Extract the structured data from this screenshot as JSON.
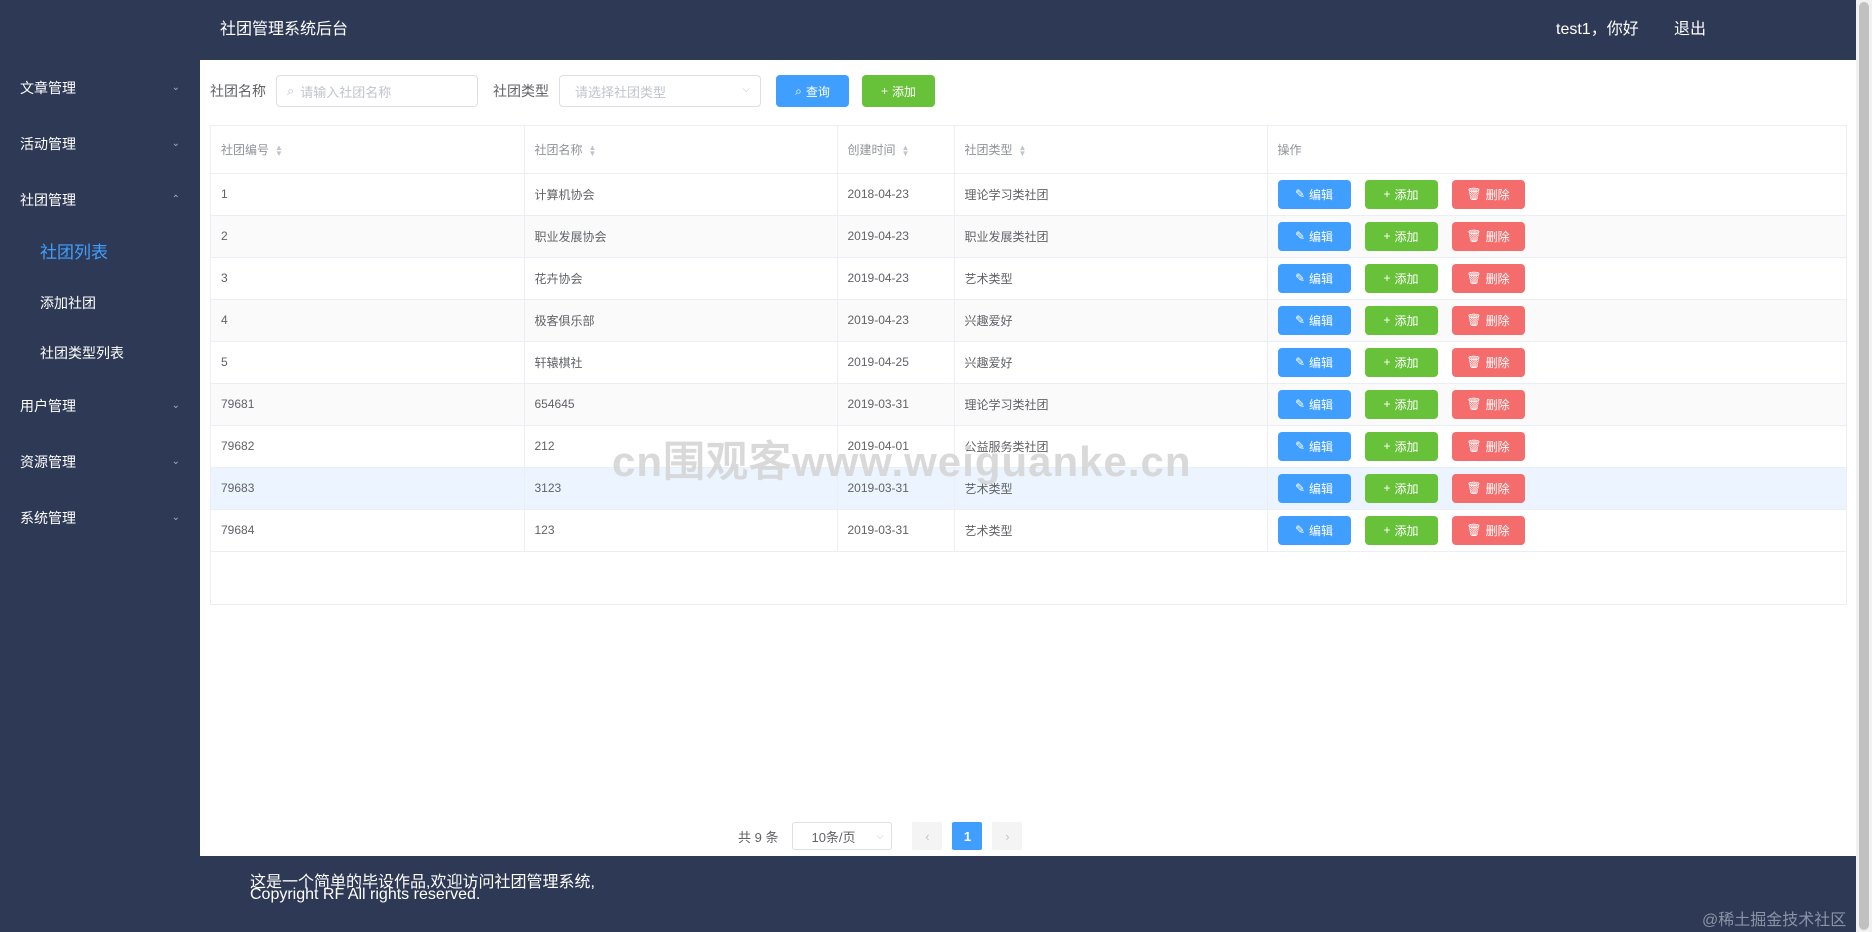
{
  "header": {
    "title": "社团管理系统后台",
    "user": "test1，你好",
    "logout": "退出"
  },
  "sidebar": {
    "menus": [
      {
        "label": "文章管理",
        "arrow": "⌄"
      },
      {
        "label": "活动管理",
        "arrow": "⌄"
      },
      {
        "label": "社团管理",
        "arrow": "⌃"
      },
      {
        "label": "用户管理",
        "arrow": "⌄"
      },
      {
        "label": "资源管理",
        "arrow": "⌄"
      },
      {
        "label": "系统管理",
        "arrow": "⌄"
      }
    ],
    "club_submenu": [
      "社团列表",
      "添加社团",
      "社团类型列表"
    ]
  },
  "search": {
    "name_label": "社团名称",
    "name_placeholder": "请输入社团名称",
    "type_label": "社团类型",
    "type_placeholder": "请选择社团类型",
    "query_button": "查询",
    "add_button": "添加"
  },
  "table": {
    "headers": [
      "社团编号",
      "社团名称",
      "创建时间",
      "社团类型",
      "操作"
    ],
    "rows": [
      [
        "1",
        "计算机协会",
        "2018-04-23",
        "理论学习类社团"
      ],
      [
        "2",
        "职业发展协会",
        "2019-04-23",
        "职业发展类社团"
      ],
      [
        "3",
        "花卉协会",
        "2019-04-23",
        "艺术类型"
      ],
      [
        "4",
        "极客俱乐部",
        "2019-04-23",
        "兴趣爱好"
      ],
      [
        "5",
        "轩辕棋社",
        "2019-04-25",
        "兴趣爱好"
      ],
      [
        "79681",
        "654645",
        "2019-03-31",
        "理论学习类社团"
      ],
      [
        "79682",
        "212",
        "2019-04-01",
        "公益服务类社团"
      ],
      [
        "79683",
        "3123",
        "2019-03-31",
        "艺术类型"
      ],
      [
        "79684",
        "123",
        "2019-03-31",
        "艺术类型"
      ]
    ],
    "row_buttons": {
      "edit": "编辑",
      "add": "添加",
      "delete": "删除"
    }
  },
  "pagination": {
    "total": "共 9 条",
    "page_size": "10条/页",
    "current_page": "1"
  },
  "footer": {
    "line1": "这是一个简单的毕设作品,欢迎访问社团管理系统,",
    "line2": "Copyright RF All rights reserved.",
    "site_mark": "@稀土掘金技术社区"
  },
  "watermark": "cn围观客www.weiguanke.cn",
  "colors": {
    "nav_bg": "#2e3a55",
    "primary": "#409eff",
    "success": "#67c23a",
    "danger": "#f56c6c"
  }
}
